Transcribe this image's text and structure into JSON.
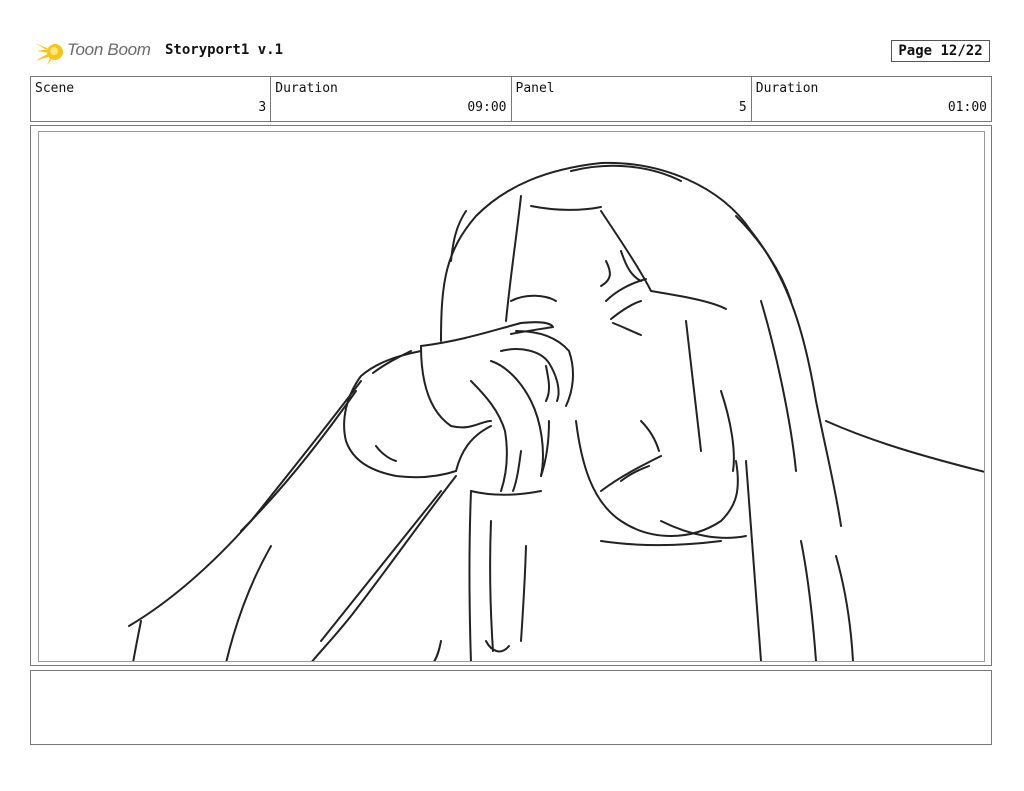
{
  "header": {
    "logo_text": "Toon Boom",
    "app_title": "Storyport1 v.1",
    "page": "Page 12/22"
  },
  "info": {
    "scene_label": "Scene",
    "scene_value": "3",
    "scene_duration_label": "Duration",
    "scene_duration_value": "09:00",
    "panel_label": "Panel",
    "panel_value": "5",
    "panel_duration_label": "Duration",
    "panel_duration_value": "01:00"
  },
  "colors": {
    "logo_accent": "#f5c518",
    "border": "#777777",
    "sketch_stroke": "#222222"
  },
  "notes": {
    "text": ""
  }
}
